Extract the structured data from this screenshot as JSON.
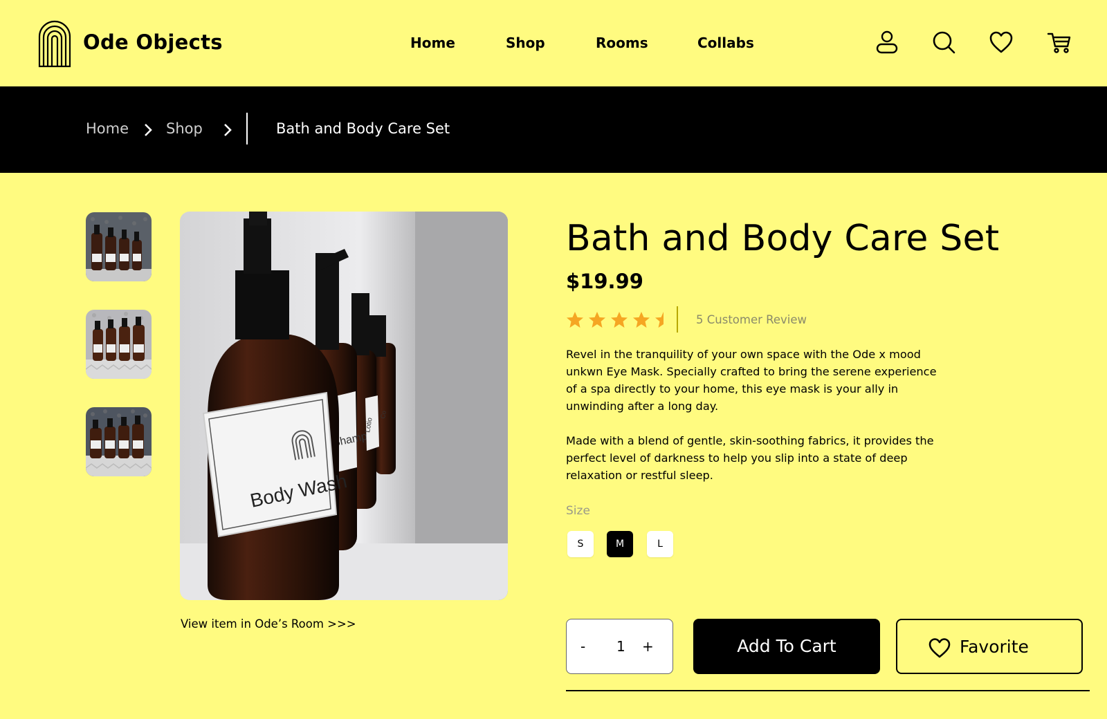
{
  "header": {
    "brand": "Ode Objects",
    "nav": [
      "Home",
      "Shop",
      "Rooms",
      "Collabs"
    ],
    "icons": [
      "user-icon",
      "search-icon",
      "heart-icon",
      "cart-icon"
    ]
  },
  "breadcrumb": {
    "items": [
      "Home",
      "Shop"
    ],
    "current": "Bath and Body Care Set"
  },
  "gallery": {
    "thumbnails": 3,
    "bottle_labels": [
      "Body Wash",
      "Shampoo",
      "Lotion",
      "Co"
    ],
    "view_room_link": "View item in Ode’s Room >>>"
  },
  "product": {
    "title": "Bath and Body Care Set",
    "price": "$19.99",
    "rating": 4.5,
    "rating_max": 5,
    "reviews": "5 Customer Review",
    "description": [
      "Revel in the tranquility of your own space with the Ode x mood unkwn Eye Mask. Specially crafted to bring the serene experience of a spa directly to your home, this eye mask is your ally in unwinding after a long day.",
      "Made with a blend of gentle, skin-soothing fabrics, it provides the perfect level of darkness to help you slip into a state of deep relaxation or restful sleep."
    ],
    "size_label": "Size",
    "sizes": [
      "S",
      "M",
      "L"
    ],
    "selected_size": "M"
  },
  "cart": {
    "minus": "-",
    "quantity": "1",
    "plus": "+",
    "add_to_cart": "Add To Cart",
    "favorite": "Favorite"
  },
  "colors": {
    "background": "#fffb80",
    "star": "#f5a623",
    "dark": "#000000"
  }
}
